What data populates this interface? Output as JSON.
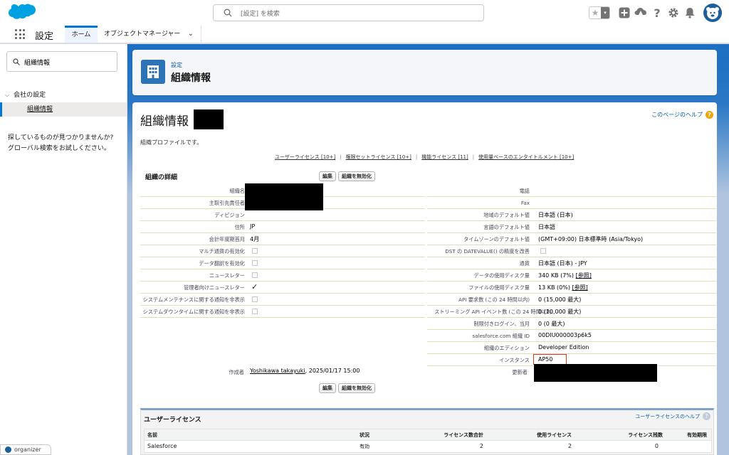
{
  "header": {
    "search_placeholder": "[設定] を検索"
  },
  "appnav": {
    "app_name": "設定",
    "tabs": [
      {
        "label": "ホーム"
      },
      {
        "label": "オブジェクトマネージャー"
      }
    ]
  },
  "sidebar": {
    "quickfind_value": "組織情報",
    "tree_parent": "会社の設定",
    "tree_child": "組織情報",
    "help_line1": "探しているものが見つかりませんか?",
    "help_line2": "グローバル検索をお試しください。"
  },
  "setup_header": {
    "kicker": "設定",
    "title": "組織情報"
  },
  "page": {
    "title": "組織情報",
    "help_link": "このページのヘルプ",
    "description": "組織プロファイルです。",
    "links": [
      {
        "label": "ユーザーライセンス",
        "count": "[10+]"
      },
      {
        "label": "権限セットライセンス",
        "count": "[10+]"
      },
      {
        "label": "機能ライセンス",
        "count": "[11]"
      },
      {
        "label": "使用量ベースのエンタイトルメント",
        "count": "[10+]"
      }
    ]
  },
  "details": {
    "section_title": "組織の詳細",
    "edit_button": "編集",
    "deactivate_button": "組織を無効化",
    "left": [
      {
        "label": "組織名",
        "value": ""
      },
      {
        "label": "主取引先責任者",
        "value": ""
      },
      {
        "label": "ディビジョン",
        "value": ""
      },
      {
        "label": "住所",
        "value": "JP"
      },
      {
        "label": "会計年度期首月",
        "value": "4月"
      },
      {
        "label": "マルチ通貨の有効化",
        "checkbox": true
      },
      {
        "label": "データ翻訳を有効化",
        "checkbox": true
      },
      {
        "label": "ニュースレター",
        "checkbox": true
      },
      {
        "label": "管理者向けニュースレター",
        "checked": "✓"
      },
      {
        "label": "システムメンテナンスに関する通知を非表示",
        "checkbox": true
      },
      {
        "label": "システムダウンタイムに関する通知を非表示",
        "checkbox": true
      }
    ],
    "right": [
      {
        "label": "電話",
        "value": ""
      },
      {
        "label": "Fax",
        "value": ""
      },
      {
        "label": "地域のデフォルト値",
        "value": "日本語 (日本)"
      },
      {
        "label": "言語のデフォルト値",
        "value": "日本語"
      },
      {
        "label": "タイムゾーンのデフォルト値",
        "value": "(GMT+09:00) 日本標準時 (Asia/Tokyo)"
      },
      {
        "label": "DST の DATEVALUE() の精度を改善",
        "checkbox": true
      },
      {
        "label": "通貨",
        "value": "日本語 (日本) - JPY"
      },
      {
        "label": "データの使用ディスク量",
        "value": "340 KB (7%)",
        "link": "[参照]"
      },
      {
        "label": "ファイルの使用ディスク量",
        "value": "13 KB (0%)",
        "link": "[参照]"
      },
      {
        "label": "API 要求数 (この 24 時間以内)",
        "value": "0 (15,000 最大)"
      },
      {
        "label": "ストリーミング API イベント数 (この 24 時間以内)",
        "value": "0 (10,000 最大)"
      },
      {
        "label": "制限付きログイン、当月",
        "value": "0 (0 最大)"
      },
      {
        "label": "salesforce.com 組織 ID",
        "value": "00DIU000003p6k5"
      },
      {
        "label": "組織のエディション",
        "value": "Developer Edition"
      },
      {
        "label": "インスタンス",
        "value": "AP50"
      }
    ],
    "created_by_label": "作成者",
    "created_by_name": "Yoshikawa takayuki",
    "created_by_date": ", 2025/01/17 15:00",
    "modified_by_label": "更新者"
  },
  "license": {
    "title": "ユーザーライセンス",
    "help_link": "ユーザーライセンスのヘルプ",
    "columns": [
      "名前",
      "状況",
      "ライセンス数合計",
      "使用ライセンス",
      "ライセンス残数",
      "有効期限"
    ],
    "rows": [
      {
        "name": "Salesforce",
        "status": "有効",
        "total": "2",
        "used": "2",
        "remaining": "0",
        "expires": ""
      }
    ]
  },
  "footer": {
    "organizer_label": "organizer"
  },
  "colors": {
    "brand": "#00a1e0",
    "accent": "#0176d3",
    "highlight": "#d93a1a"
  }
}
